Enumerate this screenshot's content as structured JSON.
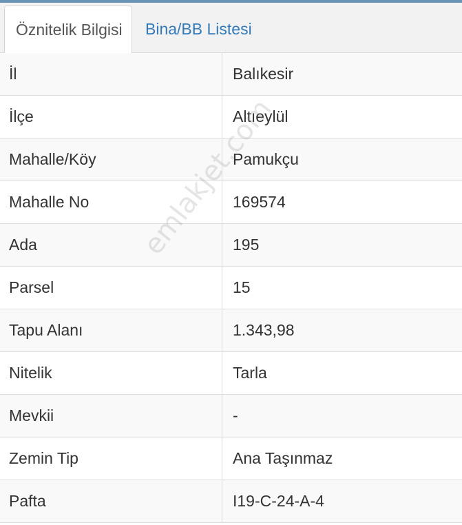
{
  "tabs": {
    "active_label": "Öznitelik Bilgisi",
    "second_label": "Bina/BB Listesi"
  },
  "rows": [
    {
      "label": "İl",
      "value": "Balıkesir"
    },
    {
      "label": "İlçe",
      "value": "Altıeylül"
    },
    {
      "label": "Mahalle/Köy",
      "value": "Pamukçu"
    },
    {
      "label": "Mahalle No",
      "value": "169574"
    },
    {
      "label": "Ada",
      "value": "195"
    },
    {
      "label": "Parsel",
      "value": "15"
    },
    {
      "label": "Tapu Alanı",
      "value": "1.343,98"
    },
    {
      "label": "Nitelik",
      "value": "Tarla"
    },
    {
      "label": "Mevkii",
      "value": "-"
    },
    {
      "label": "Zemin Tip",
      "value": "Ana Taşınmaz"
    },
    {
      "label": "Pafta",
      "value": "I19-C-24-A-4"
    }
  ],
  "watermark": "emlakjet.com",
  "colors": {
    "tab_link": "#337ab7",
    "top_line": "#6a93b8",
    "text": "#333333"
  }
}
